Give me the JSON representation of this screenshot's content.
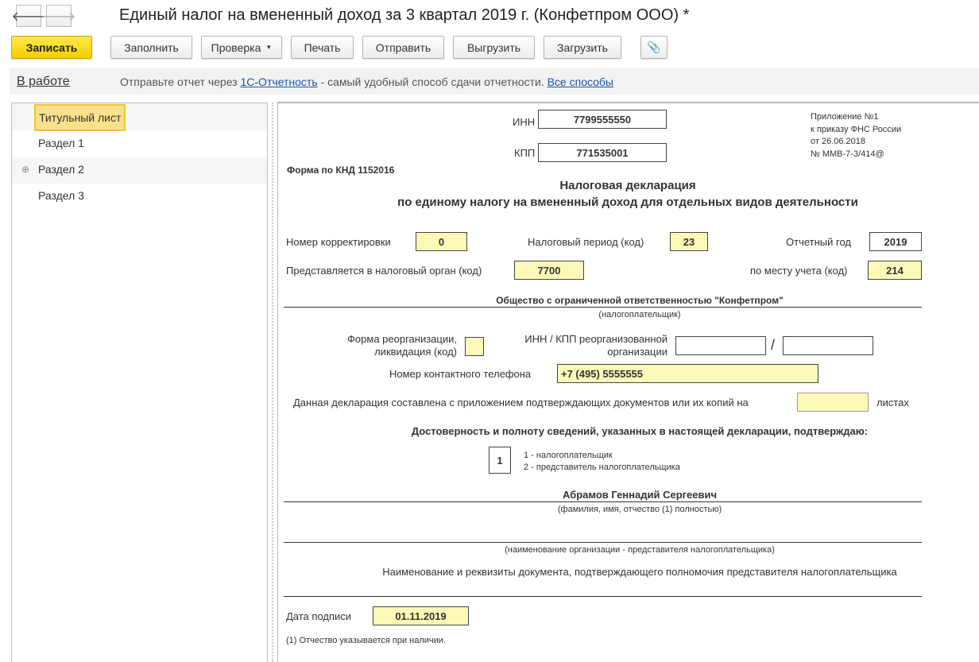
{
  "title": "Единый налог на вмененный доход за 3 квартал 2019 г. (Конфетпром ООО) *",
  "toolbar": {
    "save": "Записать",
    "fill": "Заполнить",
    "check": "Проверка",
    "print": "Печать",
    "send": "Отправить",
    "export": "Выгрузить",
    "import": "Загрузить"
  },
  "infobar": {
    "status": "В работе",
    "text1": "Отправьте отчет через",
    "link1": "1С-Отчетность",
    "text2": "- самый удобный способ сдачи отчетности.",
    "link2": "Все способы"
  },
  "sidebar": {
    "items": [
      {
        "label": "Титульный лист"
      },
      {
        "label": "Раздел 1"
      },
      {
        "label": "Раздел 2"
      },
      {
        "label": "Раздел 3"
      }
    ]
  },
  "form": {
    "inn_label": "ИНН",
    "inn": "7799555550",
    "kpp_label": "КПП",
    "kpp": "771535001",
    "appendix": [
      "Приложение №1",
      "к приказу ФНС России",
      "от 26.06.2018",
      "№ ММВ-7-3/414@"
    ],
    "knd": "Форма по КНД 1152016",
    "heading1": "Налоговая декларация",
    "heading2": "по единому налогу на вмененный доход для отдельных видов деятельности",
    "corr_label": "Номер корректировки",
    "corr": "0",
    "period_label": "Налоговый период (код)",
    "period": "23",
    "year_label": "Отчетный год",
    "year": "2019",
    "organ_label": "Представляется в налоговый орган (код)",
    "organ": "7700",
    "place_label": "по месту учета (код)",
    "place": "214",
    "org_name": "Общество с ограниченной ответственностью \"Конфетпром\"",
    "org_caption": "(налогоплательщик)",
    "reorg_label1": "Форма реорганизации,",
    "reorg_label2": "ликвидация (код)",
    "reorg_inn_label1": "ИНН / КПП реорганизованной",
    "reorg_inn_label2": "организации",
    "slash": "/",
    "phone_label": "Номер контактного телефона",
    "phone": "+7 (495) 5555555",
    "pages_label": "Данная декларация составлена с приложением подтверждающих документов или их копий на",
    "pages_suffix": "листах",
    "confirm": "Достоверность и полноту сведений, указанных в настоящей декларации, подтверждаю:",
    "signer_code": "1",
    "signer_opt1": "1 - налогоплательщик",
    "signer_opt2": "2 - представитель налогоплательщика",
    "fio": "Абрамов Геннадий Сергеевич",
    "fio_caption": "(фамилия, имя, отчество (1) полностью)",
    "rep_caption": "(наименование организации - представителя налогоплательщика)",
    "doc_label": "Наименование и реквизиты документа, подтверждающего полномочия представителя налогоплательщика",
    "date_label": "Дата подписи",
    "date": "01.11.2019",
    "footnote": "(1) Отчество указывается при наличии."
  }
}
